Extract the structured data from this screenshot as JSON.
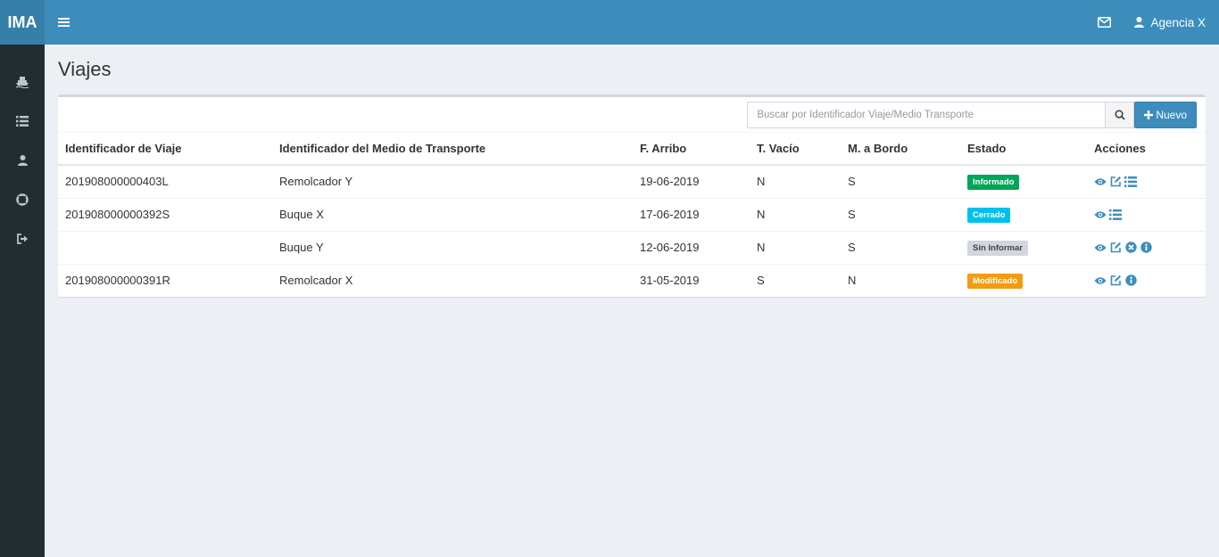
{
  "app": {
    "logo": "IMA"
  },
  "header": {
    "user": "Agencia X"
  },
  "page": {
    "title": "Viajes"
  },
  "search": {
    "placeholder": "Buscar por Identificador Viaje/Medio Transporte",
    "value": ""
  },
  "buttons": {
    "new_label": "Nuevo"
  },
  "table": {
    "headers": {
      "id": "Identificador de Viaje",
      "medio": "Identificador del Medio de Transporte",
      "arribo": "F. Arribo",
      "vacio": "T. Vacío",
      "bordo": "M. a Bordo",
      "estado": "Estado",
      "acciones": "Acciones"
    },
    "rows": [
      {
        "id": "201908000000403L",
        "medio": "Remolcador Y",
        "arribo": "19-06-2019",
        "vacio": "N",
        "bordo": "S",
        "estado": "Informado"
      },
      {
        "id": "201908000000392S",
        "medio": "Buque X",
        "arribo": "17-06-2019",
        "vacio": "N",
        "bordo": "S",
        "estado": "Cerrado"
      },
      {
        "id": "",
        "medio": "Buque Y",
        "arribo": "12-06-2019",
        "vacio": "N",
        "bordo": "S",
        "estado": "Sin Informar"
      },
      {
        "id": "201908000000391R",
        "medio": "Remolcador X",
        "arribo": "31-05-2019",
        "vacio": "S",
        "bordo": "N",
        "estado": "Modificado"
      }
    ]
  },
  "colors": {
    "header": "#3c8dbc",
    "logo_bg": "#367fa9",
    "sidebar": "#222d32",
    "badge_informado": "#00a65a",
    "badge_cerrado": "#00c0ef",
    "badge_sin_informar": "#d2d6de",
    "badge_modificado": "#f39c12",
    "action_icon": "#3c8dbc"
  },
  "icons": {
    "menu": "bars-icon",
    "mail": "envelope-icon",
    "user": "user-icon",
    "sidebar": [
      "ship-icon",
      "list-icon",
      "user-icon",
      "lifebuoy-icon",
      "sign-out-icon"
    ],
    "actions": [
      "eye-icon",
      "edit-icon",
      "list-icon",
      "times-circle-icon",
      "info-circle-icon"
    ]
  }
}
